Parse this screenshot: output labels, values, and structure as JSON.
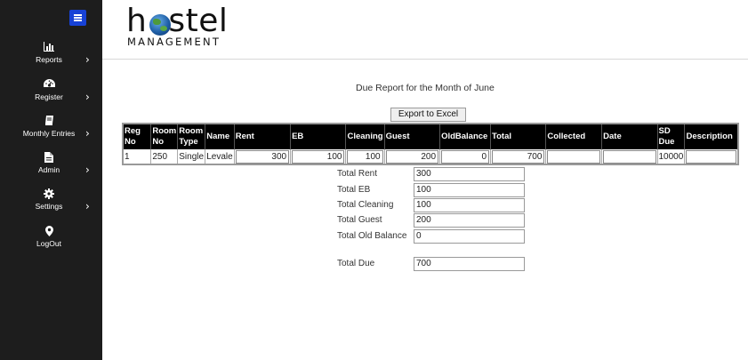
{
  "sidebar": {
    "items": [
      {
        "label": "Reports",
        "icon": "bar-chart-icon"
      },
      {
        "label": "Register",
        "icon": "dashboard-icon"
      },
      {
        "label": "Monthly Entries",
        "icon": "book-icon"
      },
      {
        "label": "Admin",
        "icon": "file-icon"
      },
      {
        "label": "Settings",
        "icon": "gear-icon"
      },
      {
        "label": "LogOut",
        "icon": "map-pin-icon"
      }
    ],
    "chevron": "›"
  },
  "logo": {
    "h": "h",
    "stel": "stel",
    "subtitle": "MANAGEMENT"
  },
  "report": {
    "title": "Due Report for the Month of June",
    "export_label": "Export to Excel"
  },
  "table": {
    "headers": [
      "Reg No",
      "Room No",
      "Room Type",
      "Name",
      "Rent",
      "EB",
      "Cleaning",
      "Guest",
      "OldBalance",
      "Total",
      "Collected",
      "Date",
      "SD Due",
      "Description"
    ],
    "rows": [
      [
        "1",
        "250",
        "Single",
        "Levale",
        "300",
        "100",
        "100",
        "200",
        "0",
        "700",
        "",
        "",
        "10000",
        ""
      ]
    ]
  },
  "totals": [
    {
      "label": "Total Rent",
      "value": "300"
    },
    {
      "label": "Total EB",
      "value": "100"
    },
    {
      "label": "Total Cleaning",
      "value": "100"
    },
    {
      "label": "Total Guest",
      "value": "200"
    },
    {
      "label": "Total Old Balance",
      "value": "0"
    },
    {
      "label": "Total Due",
      "value": "700"
    }
  ],
  "colors": {
    "sidebar_bg": "#1d1d1d",
    "menu_button": "#1742d6",
    "table_header_bg": "#000000"
  }
}
